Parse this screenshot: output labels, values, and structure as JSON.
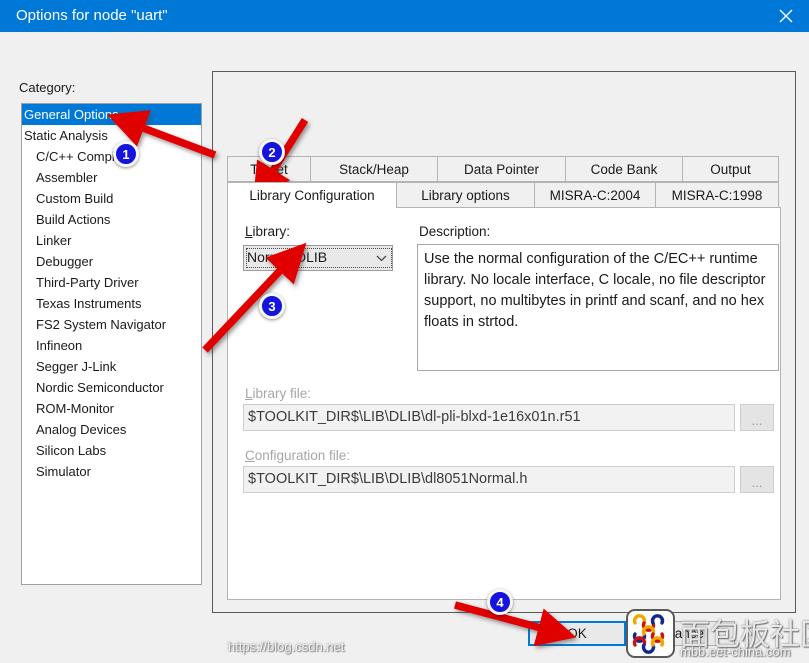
{
  "window": {
    "title": "Options for node \"uart\"",
    "close_icon": "close-icon",
    "accent_color": "#0078d7"
  },
  "sidebar": {
    "label": "Category:",
    "items": [
      {
        "label": "General Options",
        "indent": false,
        "selected": true
      },
      {
        "label": "Static Analysis",
        "indent": false,
        "selected": false
      },
      {
        "label": "C/C++ Compiler",
        "indent": true,
        "selected": false
      },
      {
        "label": "Assembler",
        "indent": true,
        "selected": false
      },
      {
        "label": "Custom Build",
        "indent": true,
        "selected": false
      },
      {
        "label": "Build Actions",
        "indent": true,
        "selected": false
      },
      {
        "label": "Linker",
        "indent": true,
        "selected": false
      },
      {
        "label": "Debugger",
        "indent": true,
        "selected": false
      },
      {
        "label": "Third-Party Driver",
        "indent": true,
        "selected": false
      },
      {
        "label": "Texas Instruments",
        "indent": true,
        "selected": false
      },
      {
        "label": "FS2 System Navigator",
        "indent": true,
        "selected": false
      },
      {
        "label": "Infineon",
        "indent": true,
        "selected": false
      },
      {
        "label": "Segger J-Link",
        "indent": true,
        "selected": false
      },
      {
        "label": "Nordic Semiconductor",
        "indent": true,
        "selected": false
      },
      {
        "label": "ROM-Monitor",
        "indent": true,
        "selected": false
      },
      {
        "label": "Analog Devices",
        "indent": true,
        "selected": false
      },
      {
        "label": "Silicon Labs",
        "indent": true,
        "selected": false
      },
      {
        "label": "Simulator",
        "indent": true,
        "selected": false
      }
    ]
  },
  "tabs": {
    "row1": [
      {
        "label": "Target",
        "selected": false
      },
      {
        "label": "Stack/Heap",
        "selected": false
      },
      {
        "label": "Data Pointer",
        "selected": false
      },
      {
        "label": "Code Bank",
        "selected": false
      },
      {
        "label": "Output",
        "selected": false
      }
    ],
    "row2": [
      {
        "label": "Library Configuration",
        "selected": true
      },
      {
        "label": "Library options",
        "selected": false
      },
      {
        "label": "MISRA-C:2004",
        "selected": false
      },
      {
        "label": "MISRA-C:1998",
        "selected": false
      }
    ]
  },
  "form": {
    "library_label": "Library:",
    "library_value": "Normal DLIB",
    "library_dropdown_icon": "chevron-down-icon",
    "description_label": "Description:",
    "description_value": "Use the normal configuration of the C/EC++ runtime library. No locale interface, C locale, no file descriptor support, no multibytes in printf and scanf, and no hex floats in strtod.",
    "library_file_label": "Library file:",
    "library_file_value": "$TOOLKIT_DIR$\\LIB\\DLIB\\dl-pli-blxd-1e16x01n.r51",
    "library_file_browse": "...",
    "config_file_label": "Configuration file:",
    "config_file_value": "$TOOLKIT_DIR$\\LIB\\DLIB\\dl8051Normal.h",
    "config_file_browse": "..."
  },
  "buttons": {
    "ok": "OK",
    "cancel": "Cancel"
  },
  "annotations": {
    "badges": [
      {
        "number": "1"
      },
      {
        "number": "2"
      },
      {
        "number": "3"
      },
      {
        "number": "4"
      }
    ],
    "arrow_color": "#e00000"
  },
  "watermark": {
    "site_name": "面包板社区",
    "url": "mbb.eet-china.com",
    "url_secondary": "https://blog.csdn.net"
  }
}
